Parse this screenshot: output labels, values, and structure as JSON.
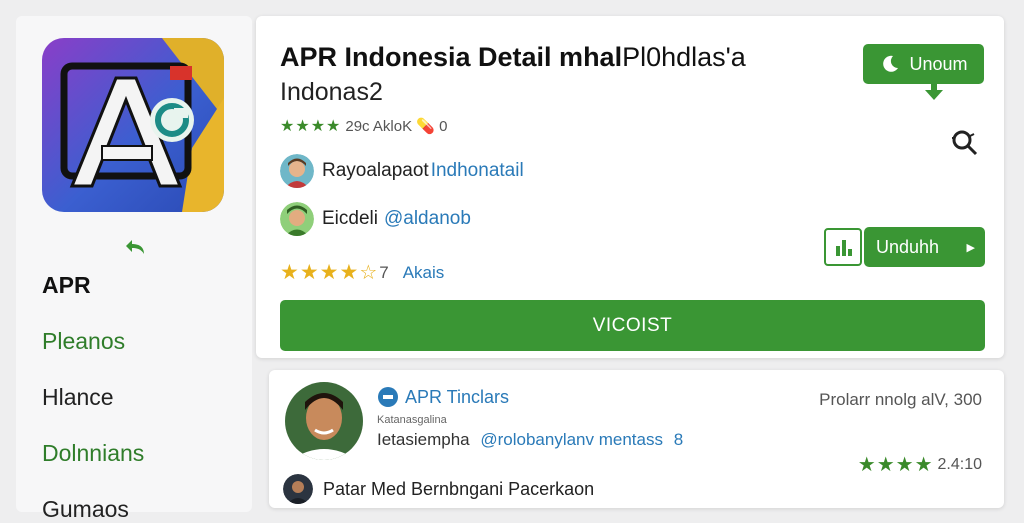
{
  "colors": {
    "accent_green": "#3a9634",
    "star_gold": "#e8b11c",
    "link_blue": "#2a7ab8"
  },
  "sidebar": {
    "title": "APR",
    "items": [
      {
        "label": "Pleanos",
        "color": "#2f7d2a"
      },
      {
        "label": "Hlance",
        "color": "#222222"
      },
      {
        "label": "Dolnnians",
        "color": "#2f7d2a"
      },
      {
        "label": "Gumaos",
        "color": "#222222"
      }
    ]
  },
  "header": {
    "title_bold": "APR Indonesia Detail mhal",
    "title_rest": "Pl0hdlas'a",
    "subtitle": "Indonas2",
    "rating_stars": "★★★★",
    "rating_text": "29c AkloK 💊 0",
    "install_button_label": "Unoum"
  },
  "developers": [
    {
      "name": "Rayoalapaot",
      "link": "Indhonatail"
    },
    {
      "name": "Eicdeli",
      "link": "@aldanob"
    }
  ],
  "rating": {
    "value": 4.7,
    "stars": "★★★★",
    "score_text": "7",
    "label": "Akais"
  },
  "download_button_label": "Unduhh",
  "primary_bar_label": "VICOIST",
  "review": {
    "name": "APR Tinclars",
    "meta": "Prolarr nnolg alV, 300",
    "small_text": "Katanasgalina",
    "body_text": "Ietasiempha",
    "body_link": "@rolobanylanv mentass",
    "body_tail": "8",
    "stars": "★★★★",
    "score": "2.4:10",
    "footer_text": "Patar Med Bernbngani Pacerkaon"
  }
}
